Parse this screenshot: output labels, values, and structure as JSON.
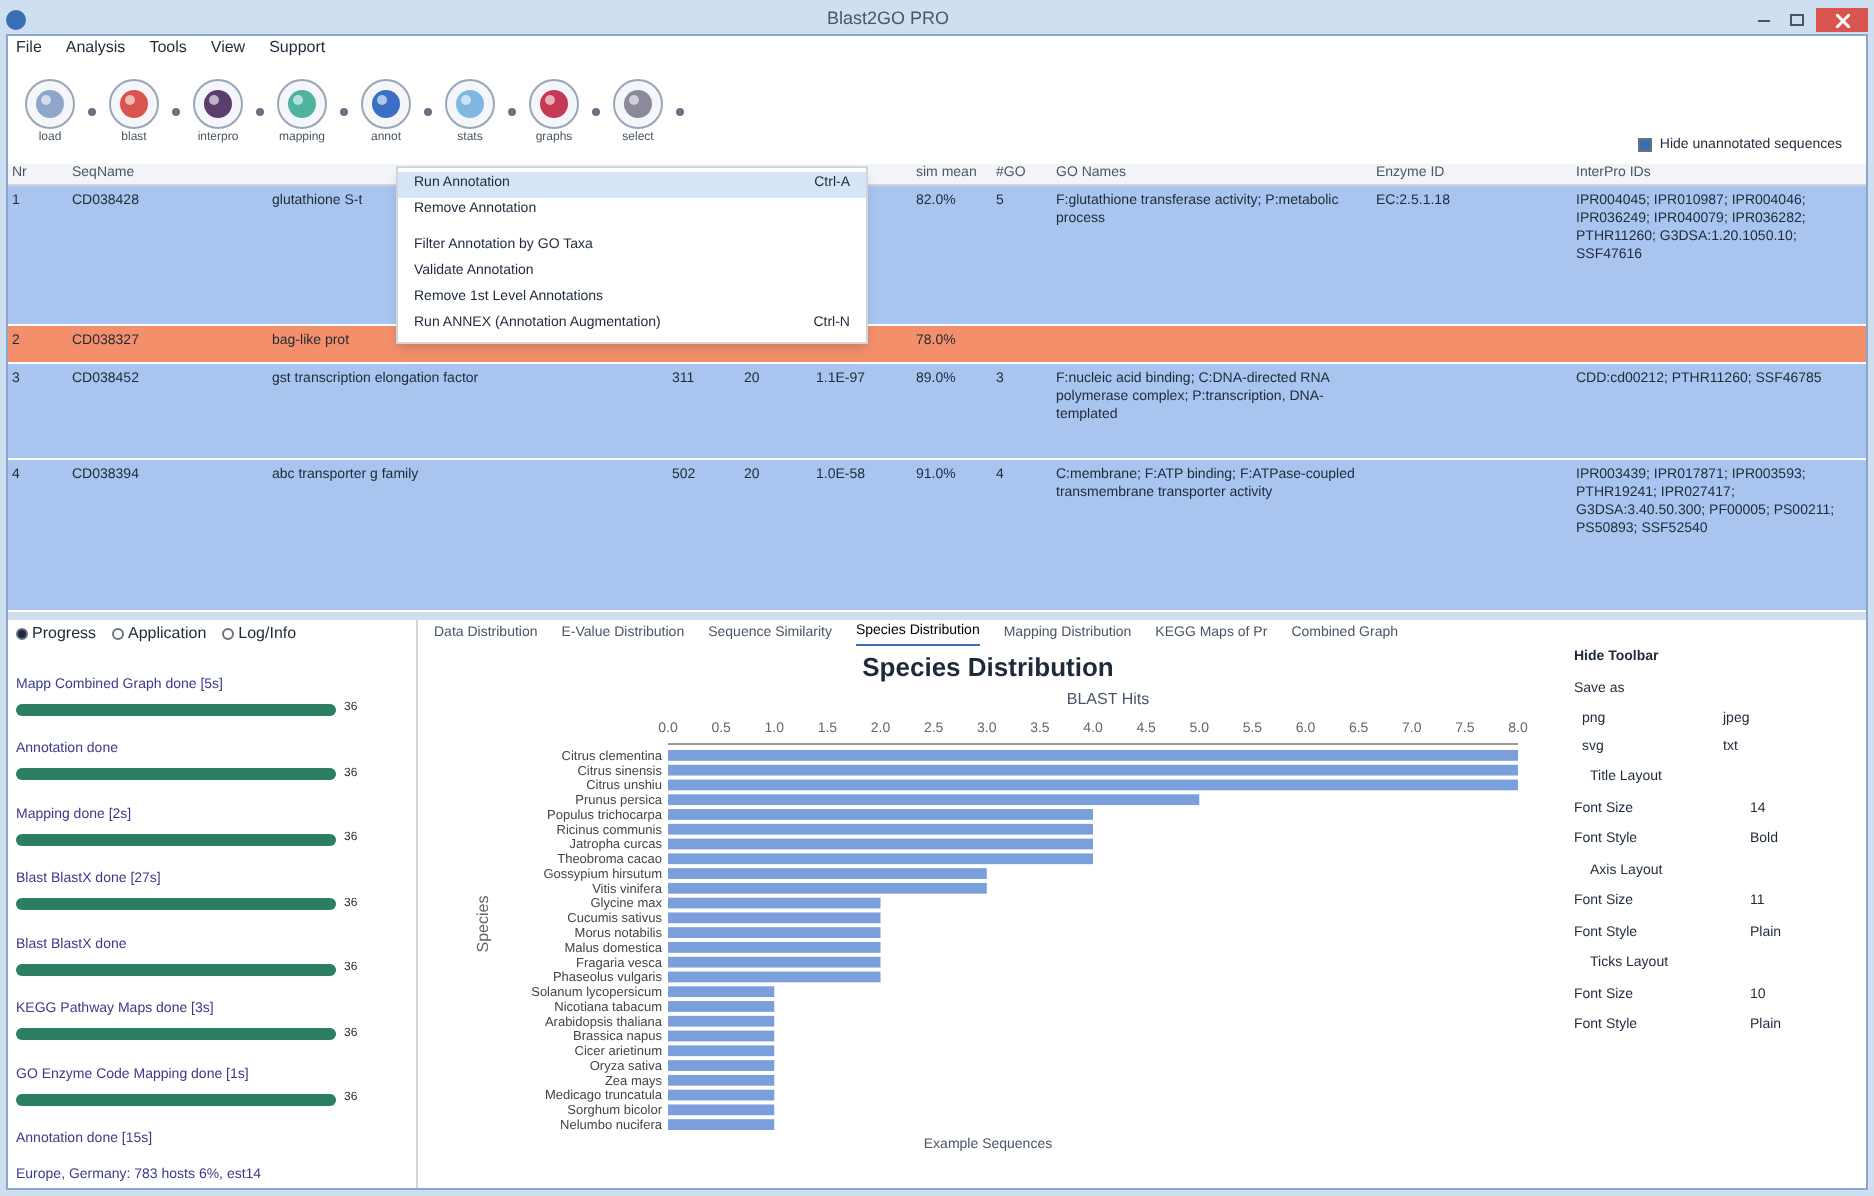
{
  "window": {
    "title": "Blast2GO PRO"
  },
  "menu": [
    "File",
    "Analysis",
    "Tools",
    "View",
    "Support"
  ],
  "toolbar": {
    "tools": [
      {
        "label": "load",
        "color": "#8fa6c8"
      },
      {
        "label": "blast",
        "color": "#d9534f"
      },
      {
        "label": "interpro",
        "color": "#5a3f6e"
      },
      {
        "label": "mapping",
        "color": "#4fb3a0"
      },
      {
        "label": "annot",
        "color": "#3a6fc4"
      },
      {
        "label": "stats",
        "color": "#7fb7e0"
      },
      {
        "label": "graphs",
        "color": "#c43a55"
      },
      {
        "label": "select",
        "color": "#8a8a9a"
      }
    ],
    "hide_unannotated": {
      "label": "Hide unannotated sequences",
      "checked": true
    }
  },
  "table": {
    "columns_left": [
      "Nr",
      "SeqName"
    ],
    "columns_right": [
      "sim mean",
      "#GO",
      "GO Names",
      "Enzyme ID",
      "InterPro IDs"
    ],
    "rows": [
      {
        "nr": "1",
        "seq_name": "CD038428",
        "description": "glutathione S-t",
        "sim": "82.0%",
        "go_count": "5",
        "go_names": "F:glutathione transferase activity; P:metabolic process",
        "enzyme": "EC:2.5.1.18",
        "interpro": "IPR004045; IPR010987; IPR004046; IPR036249; IPR040079; IPR036282; PTHR11260; G3DSA:1.20.1050.10; SSF47616",
        "color": "#a9c4ef"
      },
      {
        "nr": "2",
        "seq_name": "CD038327",
        "description": "bag-like prot",
        "sim": "78.0%",
        "color": "#f3906b"
      },
      {
        "nr": "3",
        "seq_name": "CD038452",
        "description": "gst transcription elongation factor",
        "length": "311",
        "hits": "20",
        "evalue": "1.1E-97",
        "sim": "89.0%",
        "go_count": "3",
        "go_names": "F:nucleic acid binding; C:DNA-directed RNA polymerase complex; P:transcription, DNA-templated",
        "interpro": "CDD:cd00212; PTHR11260; SSF46785",
        "color": "#a9c4ef"
      },
      {
        "nr": "4",
        "seq_name": "CD038394",
        "description": "abc transporter g family",
        "length": "502",
        "hits": "20",
        "evalue": "1.0E-58",
        "sim": "91.0%",
        "go_count": "4",
        "go_names": "C:membrane; F:ATP binding; F:ATPase-coupled transmembrane transporter activity",
        "interpro": "IPR003439; IPR017871; IPR003593; PTHR19241; IPR027417; G3DSA:3.40.50.300; PF00005; PS00211; PS50893; SSF52540",
        "color": "#a9c4ef"
      }
    ]
  },
  "context_menu": [
    {
      "label": "Run Annotation",
      "shortcut": "Ctrl-A",
      "selected": true
    },
    {
      "label": "Remove Annotation",
      "selected": false
    },
    {
      "label": "Filter Annotation by GO Taxa",
      "selected": false
    },
    {
      "label": "Validate Annotation",
      "selected": false
    },
    {
      "label": "Remove 1st Level Annotations",
      "selected": false
    },
    {
      "label": "Run ANNEX (Annotation Augmentation)",
      "shortcut": "Ctrl-N",
      "selected": false
    }
  ],
  "progress_panel": {
    "tabs": [
      {
        "label": "Progress",
        "selected": true
      },
      {
        "label": "Application",
        "selected": false
      },
      {
        "label": "Log/Info",
        "selected": false
      }
    ],
    "items": [
      {
        "label": "Mapp Combined Graph done [5s]",
        "level": 1,
        "reading": "36"
      },
      {
        "label": "Annotation done",
        "level": 1,
        "reading": "36"
      },
      {
        "label": "Mapping done [2s]",
        "level": 1,
        "reading": "36"
      },
      {
        "label": "Blast BlastX done [27s]",
        "level": 1,
        "reading": "36"
      },
      {
        "label": "Blast BlastX done",
        "level": 1,
        "reading": "36"
      },
      {
        "label": "KEGG Pathway Maps done [3s]",
        "level": 1,
        "reading": "36"
      },
      {
        "label": "GO Enzyme Code Mapping done [1s]",
        "level": 1,
        "reading": "36"
      }
    ],
    "last_item": "Annotation done [15s]",
    "status": "Europe, Germany: 783 hosts 6%, est14"
  },
  "chart_tabs": [
    {
      "label": "Data Distribution",
      "selected": false
    },
    {
      "label": "E-Value Distribution",
      "selected": false
    },
    {
      "label": "Sequence Similarity",
      "selected": false
    },
    {
      "label": "Species Distribution",
      "selected": true
    },
    {
      "label": "Mapping Distribution",
      "selected": false
    },
    {
      "label": "KEGG Maps of Pr",
      "selected": false
    },
    {
      "label": "Combined Graph",
      "selected": false
    }
  ],
  "chart": {
    "footer": "Example Sequences",
    "chart_data": {
      "type": "bar",
      "orientation": "horizontal",
      "title": "Species Distribution",
      "xlabel": "BLAST Hits",
      "ylabel": "Species",
      "categories": [
        "Citrus clementina",
        "Citrus sinensis",
        "Citrus unshiu",
        "Prunus persica",
        "Populus trichocarpa",
        "Ricinus communis",
        "Jatropha curcas",
        "Theobroma cacao",
        "Gossypium hirsutum",
        "Vitis vinifera",
        "Glycine max",
        "Cucumis sativus",
        "Morus notabilis",
        "Malus domestica",
        "Fragaria vesca",
        "Phaseolus vulgaris",
        "Solanum lycopersicum",
        "Nicotiana tabacum",
        "Arabidopsis thaliana",
        "Brassica napus",
        "Cicer arietinum",
        "Oryza sativa",
        "Zea mays",
        "Medicago truncatula",
        "Sorghum bicolor",
        "Nelumbo nucifera"
      ],
      "values": [
        8,
        8,
        8,
        5,
        4,
        4,
        4,
        4,
        3,
        3,
        2,
        2,
        2,
        2,
        2,
        2,
        1,
        1,
        1,
        1,
        1,
        1,
        1,
        1,
        1,
        1
      ],
      "xlim": [
        0,
        8
      ],
      "xticks": [
        {
          "value": 0,
          "label": "0.0"
        },
        0.5,
        {
          "value": 1,
          "label": "1.0"
        },
        1.5,
        {
          "value": 2,
          "label": "2.0"
        },
        2.5,
        {
          "value": 3,
          "label": "3.0"
        },
        3.5,
        {
          "value": 4,
          "label": "4.0"
        },
        4.5,
        {
          "value": 5,
          "label": "5.0"
        },
        5.5,
        {
          "value": 6,
          "label": "6.0"
        },
        6.5,
        {
          "value": 7,
          "label": "7.0"
        },
        7.5,
        {
          "value": 8,
          "label": "8.0"
        }
      ]
    }
  },
  "chart_toolbar": {
    "hide_label": "Hide Toolbar",
    "save_label": "Save as",
    "save_buttons": [
      "png",
      "jpeg",
      "svg",
      "txt"
    ],
    "sections": [
      {
        "title": "Title Layout",
        "size_label": "Font Size",
        "font_size": "14",
        "style_label": "Font Style",
        "font_style": "Bold"
      },
      {
        "title": "Axis Layout",
        "size_label": "Font Size",
        "font_size": "11",
        "style_label": "Font Style",
        "font_style": "Plain"
      },
      {
        "title": "Ticks Layout",
        "size_label": "Font Size",
        "font_size": "10",
        "style_label": "Font Style",
        "font_style": "Plain"
      }
    ]
  }
}
